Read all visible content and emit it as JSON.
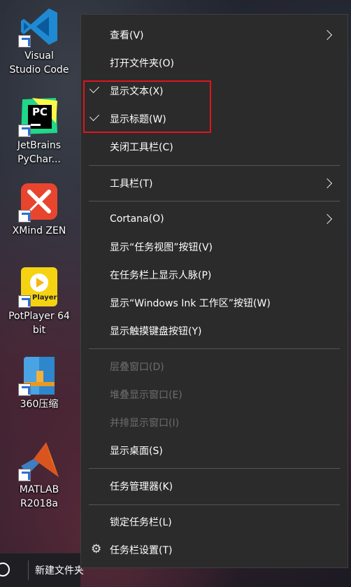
{
  "desktop": {
    "icons": [
      {
        "name": "vscode-icon",
        "label": "Visual\nStudio Code"
      },
      {
        "name": "pycharm-icon",
        "label": "JetBrains\nPyChar...",
        "badge": "PC"
      },
      {
        "name": "xmind-icon",
        "label": "XMind ZEN"
      },
      {
        "name": "potplayer-icon",
        "label": "PotPlayer 64\nbit",
        "badge": "Player"
      },
      {
        "name": "360zip-icon",
        "label": "360压缩"
      },
      {
        "name": "matlab-icon",
        "label": "MATLAB\nR2018a"
      }
    ]
  },
  "taskbar": {
    "toolbar_label": "新建文件夹"
  },
  "context_menu": {
    "items": [
      {
        "label": "查看(V)",
        "submenu": true
      },
      {
        "label": "打开文件夹(O)"
      },
      {
        "label": "显示文本(X)",
        "checked": true
      },
      {
        "label": "显示标题(W)",
        "checked": true
      },
      {
        "label": "关闭工具栏(C)"
      },
      {
        "label": "工具栏(T)",
        "submenu": true
      },
      {
        "label": "Cortana(O)",
        "submenu": true
      },
      {
        "label": "显示“任务视图”按钮(V)"
      },
      {
        "label": "在任务栏上显示人脉(P)"
      },
      {
        "label": "显示“Windows Ink 工作区”按钮(W)"
      },
      {
        "label": "显示触摸键盘按钮(Y)"
      },
      {
        "label": "层叠窗口(D)",
        "disabled": true
      },
      {
        "label": "堆叠显示窗口(E)",
        "disabled": true
      },
      {
        "label": "并排显示窗口(I)",
        "disabled": true
      },
      {
        "label": "显示桌面(S)"
      },
      {
        "label": "任务管理器(K)"
      },
      {
        "label": "锁定任务栏(L)"
      },
      {
        "label": "任务栏设置(T)",
        "icon": "gear-icon"
      }
    ]
  },
  "colors": {
    "menu_bg": "#2b2b2b",
    "highlight_border": "#e0141e",
    "disabled_text": "#6d6d6d"
  }
}
